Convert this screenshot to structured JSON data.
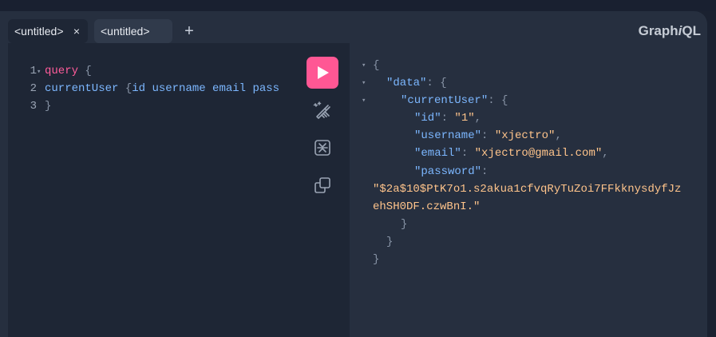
{
  "tabs": [
    {
      "label": "<untitled>",
      "close": "×",
      "active": true
    },
    {
      "label": "<untitled>",
      "active": false
    }
  ],
  "add_tab": "+",
  "logo": {
    "prefix": "Graph",
    "italic": "i",
    "suffix": "QL"
  },
  "editor": {
    "lines": [
      {
        "num": "1",
        "text": "query {"
      },
      {
        "num": "2",
        "text": "currentUser {id username email pass"
      },
      {
        "num": "3",
        "text": "}"
      }
    ]
  },
  "toolbar": {
    "run": "play-icon",
    "prettify": "magic-wand-icon",
    "merge": "merge-fragments-icon",
    "copy": "copy-icon"
  },
  "results": {
    "open_brace": "{",
    "data_key": "\"data\"",
    "current_user_key": "\"currentUser\"",
    "fields": [
      {
        "key": "\"id\"",
        "value": "\"1\""
      },
      {
        "key": "\"username\"",
        "value": "\"xjectro\""
      },
      {
        "key": "\"email\"",
        "value": "\"xjectro@gmail.com\""
      },
      {
        "key": "\"password\"",
        "value": ""
      }
    ],
    "password_value_line1": "\"$2a$10$PtK7o1.s2akua1cfvqRyTuZoi7FFkknysdyfJz",
    "password_value_line2": "ehSH0DF.czwBnI.\"",
    "close_brace": "}"
  },
  "colors": {
    "accent": "#ff5794",
    "keyword": "#ff5c9b",
    "field": "#7cb7ff",
    "string": "#ffc48b",
    "editor_bg": "#1e2635",
    "results_bg": "#262f3f"
  }
}
